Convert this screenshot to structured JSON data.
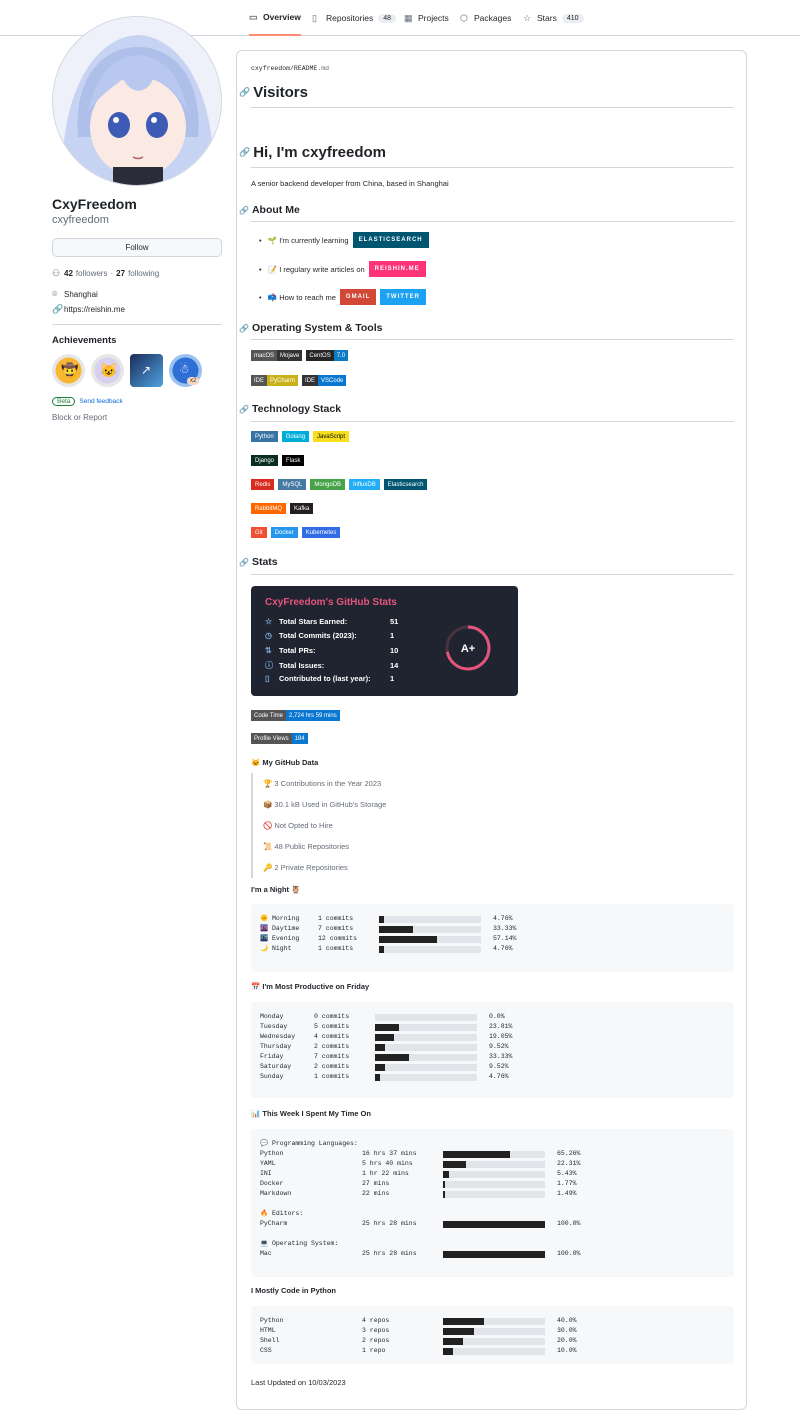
{
  "tabs": [
    {
      "label": "Overview",
      "icon": "book-icon",
      "count": null
    },
    {
      "label": "Repositories",
      "icon": "repo-icon",
      "count": "48"
    },
    {
      "label": "Projects",
      "icon": "table-icon",
      "count": null
    },
    {
      "label": "Packages",
      "icon": "package-icon",
      "count": null
    },
    {
      "label": "Stars",
      "icon": "star-icon",
      "count": "410"
    }
  ],
  "profile": {
    "name": "CxyFreedom",
    "login": "cxyfreedom",
    "follow_label": "Follow",
    "followers": "42",
    "followers_label": "followers",
    "following": "27",
    "following_label": "following",
    "sep": "·",
    "location": "Shanghai",
    "website": "https://reishin.me",
    "achievements_title": "Achievements",
    "badge_count": "x2",
    "beta_label": "Beta",
    "feedback_label": "Send feedback",
    "block_label": "Block or Report"
  },
  "readme": {
    "path_user": "cxyfreedom",
    "path_sep": "/",
    "path_file": "README",
    "path_ext": ".md",
    "visitors": "Visitors",
    "hi": "Hi, I'm cxyfreedom",
    "intro": "A senior backend developer from China, based in Shanghai",
    "about": "About Me",
    "about_items": [
      {
        "text": "🌱 I'm currently learning",
        "badges": [
          {
            "label": "ELASTICSEARCH",
            "color": "#005571"
          }
        ]
      },
      {
        "text": "📝 I regulary write articles on",
        "badges": [
          {
            "label": "REISHIN.ME",
            "color": "#ff3377"
          }
        ]
      },
      {
        "text": "📫 How to reach me",
        "badges": [
          {
            "label": "GMAIL",
            "color": "#d14836"
          },
          {
            "label": "TWITTER",
            "color": "#1da1f2"
          }
        ]
      }
    ],
    "os_title": "Operating System & Tools",
    "os_rows": [
      [
        {
          "l": "macOS",
          "r": "Mojave",
          "lc": "#555",
          "rc": "#333"
        },
        {
          "l": "CentOS",
          "r": "7.0",
          "lc": "#262626",
          "rc": "#0d7ac4"
        }
      ],
      [
        {
          "l": "IDE",
          "r": "PyCharm",
          "lc": "#555",
          "rc": "#c8b119"
        },
        {
          "l": "IDE",
          "r": "VSCode",
          "lc": "#333",
          "rc": "#0a77d1"
        }
      ]
    ],
    "tech_title": "Technology Stack",
    "tech_rows": [
      [
        {
          "t": "Python",
          "c": "#3773a4"
        },
        {
          "t": "Golang",
          "c": "#00add8"
        },
        {
          "t": "JavaScript",
          "c": "#f7df1e",
          "dark": true
        }
      ],
      [
        {
          "t": "Django",
          "c": "#092e20"
        },
        {
          "t": "Flask",
          "c": "#000000"
        }
      ],
      [
        {
          "t": "Redis",
          "c": "#d82c20"
        },
        {
          "t": "MySQL",
          "c": "#4479a1"
        },
        {
          "t": "MongoDB",
          "c": "#47a248"
        },
        {
          "t": "InfluxDB",
          "c": "#22adf6"
        },
        {
          "t": "Elasticsearch",
          "c": "#005571"
        }
      ],
      [
        {
          "t": "RabbitMQ",
          "c": "#ff6600"
        },
        {
          "t": "Kafka",
          "c": "#231f20"
        }
      ],
      [
        {
          "t": "Git",
          "c": "#f05032"
        },
        {
          "t": "Docker",
          "c": "#2496ed"
        },
        {
          "t": "Kubernetes",
          "c": "#326ce5"
        }
      ]
    ],
    "stats_title": "Stats",
    "card": {
      "title": "CxyFreedom's GitHub Stats",
      "rows": [
        {
          "icon": "star-outline-icon",
          "g": "☆",
          "label": "Total Stars Earned:",
          "value": "51"
        },
        {
          "icon": "clock-icon",
          "g": "◷",
          "label": "Total Commits (2023):",
          "value": "1"
        },
        {
          "icon": "pull-request-icon",
          "g": "⇅",
          "label": "Total PRs:",
          "value": "10"
        },
        {
          "icon": "issue-icon",
          "g": "ⓘ",
          "label": "Total Issues:",
          "value": "14"
        },
        {
          "icon": "repo-icon",
          "g": "▯",
          "label": "Contributed to (last year):",
          "value": "1"
        }
      ],
      "grade": "A+",
      "ring_fraction": 0.72
    },
    "code_time": {
      "l": "Code Time",
      "r": "2,724 hrs 59 mins"
    },
    "profile_views": {
      "l": "Profile Views",
      "r": "184"
    },
    "gh_data_title": "🐱 My GitHub Data",
    "gh_data": [
      "🏆 3 Contributions in the Year 2023",
      "📦 30.1 kB Used in GitHub's Storage",
      "🚫 Not Opted to Hire",
      "📜 48 Public Repositories",
      "🔑 2 Private Repositories"
    ],
    "night_title": "I'm a Night 🦉",
    "night": [
      {
        "n": "🌞 Morning",
        "c": "1 commits",
        "p": 4.76,
        "pt": "4.76%"
      },
      {
        "n": "🌆 Daytime",
        "c": "7 commits",
        "p": 33.33,
        "pt": "33.33%"
      },
      {
        "n": "🌃 Evening",
        "c": "12 commits",
        "p": 57.14,
        "pt": "57.14%"
      },
      {
        "n": "🌙 Night",
        "c": "1 commits",
        "p": 4.76,
        "pt": "4.76%"
      }
    ],
    "friday_title": "📅 I'm Most Productive on Friday",
    "days": [
      {
        "n": "Monday",
        "c": "0 commits",
        "p": 0,
        "pt": "0.0%"
      },
      {
        "n": "Tuesday",
        "c": "5 commits",
        "p": 23.81,
        "pt": "23.81%"
      },
      {
        "n": "Wednesday",
        "c": "4 commits",
        "p": 19.05,
        "pt": "19.05%"
      },
      {
        "n": "Thursday",
        "c": "2 commits",
        "p": 9.52,
        "pt": "9.52%"
      },
      {
        "n": "Friday",
        "c": "7 commits",
        "p": 33.33,
        "pt": "33.33%"
      },
      {
        "n": "Saturday",
        "c": "2 commits",
        "p": 9.52,
        "pt": "9.52%"
      },
      {
        "n": "Sunday",
        "c": "1 commits",
        "p": 4.76,
        "pt": "4.76%"
      }
    ],
    "week_title": "📊 This Week I Spent My Time On",
    "langs_label": "💬 Programming Languages:",
    "langs": [
      {
        "n": "Python",
        "c": "16 hrs 37 mins",
        "p": 65.26,
        "pt": "65.26%"
      },
      {
        "n": "YAML",
        "c": "5 hrs 40 mins",
        "p": 22.31,
        "pt": "22.31%"
      },
      {
        "n": "INI",
        "c": "1 hr 22 mins",
        "p": 5.43,
        "pt": "5.43%"
      },
      {
        "n": "Docker",
        "c": "27 mins",
        "p": 1.77,
        "pt": "1.77%"
      },
      {
        "n": "Markdown",
        "c": "22 mins",
        "p": 1.49,
        "pt": "1.49%"
      }
    ],
    "editors_label": "🔥 Editors:",
    "editors": [
      {
        "n": "PyCharm",
        "c": "25 hrs 28 mins",
        "p": 100,
        "pt": "100.0%"
      }
    ],
    "os_label": "💻 Operating System:",
    "oses": [
      {
        "n": "Mac",
        "c": "25 hrs 28 mins",
        "p": 100,
        "pt": "100.0%"
      }
    ],
    "python_title": "I Mostly Code in Python",
    "repos": [
      {
        "n": "Python",
        "c": "4 repos",
        "p": 40,
        "pt": "40.0%"
      },
      {
        "n": "HTML",
        "c": "3 repos",
        "p": 30,
        "pt": "30.0%"
      },
      {
        "n": "Shell",
        "c": "2 repos",
        "p": 20,
        "pt": "20.0%"
      },
      {
        "n": "CSS",
        "c": "1 repo",
        "p": 10,
        "pt": "10.0%"
      }
    ],
    "last_updated": "Last Updated on 10/03/2023"
  }
}
